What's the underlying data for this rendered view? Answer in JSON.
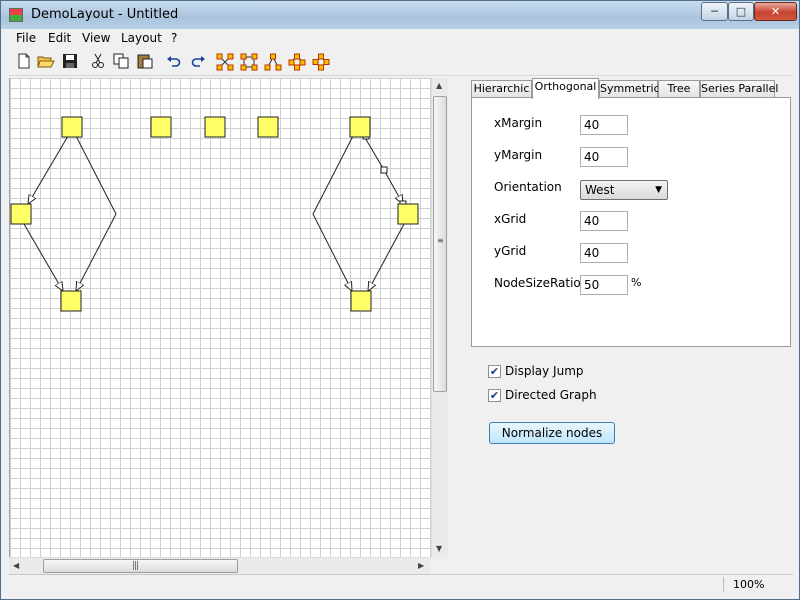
{
  "window": {
    "title": "DemoLayout - Untitled",
    "controls": {
      "minimize": "─",
      "maximize": "□",
      "close": "✕"
    }
  },
  "menu": {
    "items": [
      "File",
      "Edit",
      "View",
      "Layout",
      "?"
    ]
  },
  "toolbar": {
    "icons": [
      {
        "name": "new-file-icon",
        "glyph": "🗋"
      },
      {
        "name": "open-folder-icon",
        "glyph": "📂"
      },
      {
        "name": "save-icon",
        "glyph": "💾"
      },
      {
        "name": "cut-icon",
        "glyph": "✂"
      },
      {
        "name": "copy-icon",
        "glyph": "⧉"
      },
      {
        "name": "paste-icon",
        "glyph": "📋"
      },
      {
        "name": "undo-icon",
        "glyph": "↶"
      },
      {
        "name": "redo-icon",
        "glyph": "↷"
      },
      {
        "name": "layout-hierarchic-icon",
        "glyph": ""
      },
      {
        "name": "layout-orthogonal-icon",
        "glyph": ""
      },
      {
        "name": "layout-tree-icon",
        "glyph": ""
      },
      {
        "name": "layout-symmetric-icon",
        "glyph": ""
      },
      {
        "name": "layout-series-parallel-icon",
        "glyph": ""
      }
    ]
  },
  "tabs": [
    "Hierarchic",
    "Orthogonal",
    "Symmetric",
    "Tree",
    "Series Parallel"
  ],
  "active_tab": "Orthogonal",
  "orthogonal": {
    "xMargin_label": "xMargin",
    "xMargin": "40",
    "yMargin_label": "yMargin",
    "yMargin": "40",
    "orientation_label": "Orientation",
    "orientation": "West",
    "xGrid_label": "xGrid",
    "xGrid": "40",
    "yGrid_label": "yGrid",
    "yGrid": "40",
    "nodeSizeRatio_label": "NodeSizeRatio",
    "nodeSizeRatio": "50",
    "percent": "%"
  },
  "options": {
    "display_jump": {
      "label": "Display Jump",
      "checked": true
    },
    "directed_graph": {
      "label": "Directed Graph",
      "checked": true
    }
  },
  "normalize_button": "Normalize nodes",
  "status": {
    "zoom": "100%"
  },
  "colors": {
    "node_fill": "#ffff66",
    "node_stroke": "#222222",
    "accent": "#3c7fb1"
  }
}
